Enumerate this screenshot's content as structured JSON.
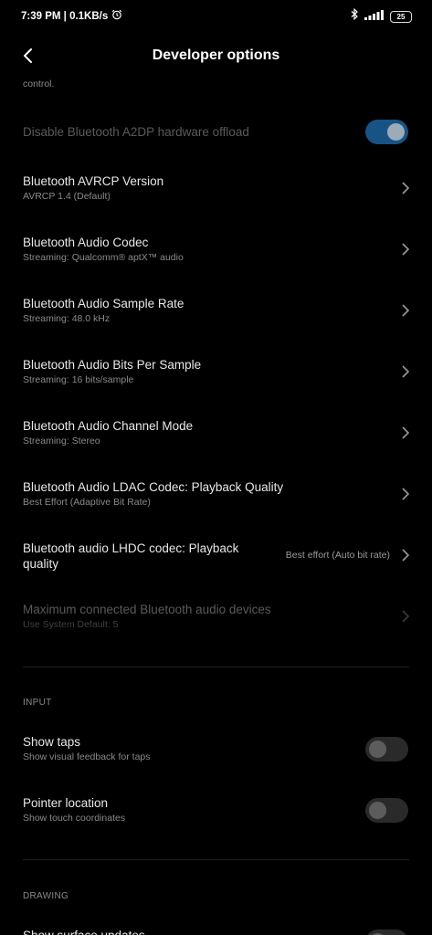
{
  "status_bar": {
    "time_speed": "7:39 PM | 0.1KB/s",
    "battery": "25",
    "icons": [
      "alarm-icon",
      "bluetooth-icon",
      "signal-icon",
      "battery-icon"
    ]
  },
  "header": {
    "title": "Developer options"
  },
  "partial_text": "control.",
  "settings": [
    {
      "title": "Disable Bluetooth A2DP hardware offload",
      "toggle_on": true,
      "disabled": true
    },
    {
      "title": "Bluetooth AVRCP Version",
      "subtitle": "AVRCP 1.4 (Default)"
    },
    {
      "title": "Bluetooth Audio Codec",
      "subtitle": "Streaming: Qualcomm® aptX™ audio"
    },
    {
      "title": "Bluetooth Audio Sample Rate",
      "subtitle": "Streaming: 48.0 kHz"
    },
    {
      "title": "Bluetooth Audio Bits Per Sample",
      "subtitle": "Streaming: 16 bits/sample"
    },
    {
      "title": "Bluetooth Audio Channel Mode",
      "subtitle": "Streaming: Stereo"
    },
    {
      "title": "Bluetooth Audio LDAC Codec: Playback Quality",
      "subtitle": "Best Effort (Adaptive Bit Rate)"
    },
    {
      "title_line1": "Bluetooth audio LHDC codec: Playback",
      "title_line2": "quality",
      "value": "Best effort (Auto bit rate)"
    },
    {
      "title": "Maximum connected Bluetooth audio devices",
      "subtitle": "Use System Default: 5",
      "disabled": true
    }
  ],
  "input_section": {
    "header": "INPUT",
    "items": [
      {
        "title": "Show taps",
        "subtitle": "Show visual feedback for taps",
        "toggle_on": false
      },
      {
        "title": "Pointer location",
        "subtitle": "Show touch coordinates",
        "toggle_on": false
      }
    ]
  },
  "drawing_section": {
    "header": "DRAWING",
    "items": [
      {
        "title": "Show surface updates",
        "toggle_on": false
      }
    ]
  }
}
